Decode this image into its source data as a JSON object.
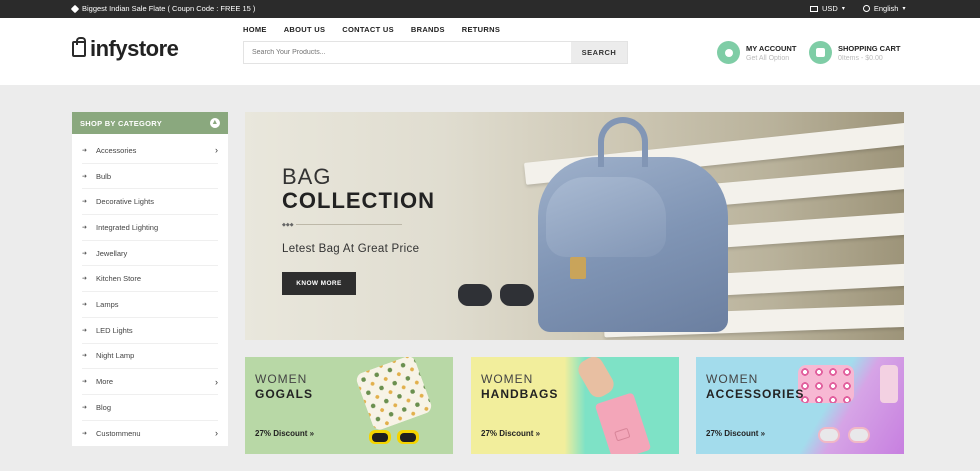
{
  "topbar": {
    "promo": "Biggest Indian Sale Flate ( Coupn Code : FREE 15 )",
    "currency": "USD",
    "language": "English"
  },
  "header": {
    "logo": "infystore",
    "nav": [
      "HOME",
      "ABOUT US",
      "CONTACT US",
      "BRANDS",
      "RETURNS"
    ],
    "search_placeholder": "Search Your Products...",
    "search_button": "SEARCH",
    "account_title": "MY ACCOUNT",
    "account_sub": "Get All Option",
    "cart_title": "SHOPPING CART",
    "cart_sub": "0Items - $0.00"
  },
  "sidebar": {
    "title": "SHOP BY CATEGORY",
    "items": [
      {
        "label": "Accessories",
        "has_sub": true
      },
      {
        "label": "Bulb",
        "has_sub": false
      },
      {
        "label": "Decorative Lights",
        "has_sub": false
      },
      {
        "label": "Integrated Lighting",
        "has_sub": false
      },
      {
        "label": "Jewellary",
        "has_sub": false
      },
      {
        "label": "Kitchen Store",
        "has_sub": false
      },
      {
        "label": "Lamps",
        "has_sub": false
      },
      {
        "label": "LED Lights",
        "has_sub": false
      },
      {
        "label": "Night Lamp",
        "has_sub": false
      },
      {
        "label": "More",
        "has_sub": true
      },
      {
        "label": "Blog",
        "has_sub": false
      },
      {
        "label": "Custommenu",
        "has_sub": true
      }
    ]
  },
  "banner": {
    "title_line1": "BAG",
    "title_line2": "COLLECTION",
    "subtitle": "Letest Bag At Great Price",
    "button": "KNOW MORE"
  },
  "cards": [
    {
      "line1": "WOMEN",
      "line2": "GOGALS",
      "discount": "27% Discount »"
    },
    {
      "line1": "WOMEN",
      "line2": "HANDBAGS",
      "discount": "27% Discount »"
    },
    {
      "line1": "WOMEN",
      "line2": "ACCESSORIES",
      "discount": "27% Discount »"
    }
  ],
  "colors": {
    "accent_green": "#7fcda6",
    "sidebar_header": "#8aa87e",
    "topbar": "#2b2b2b"
  }
}
